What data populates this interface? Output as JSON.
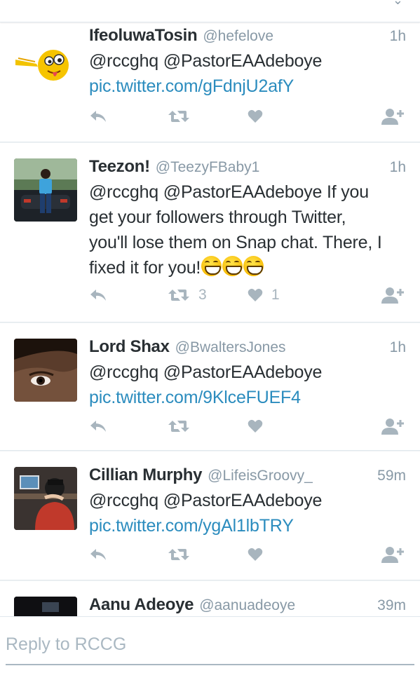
{
  "timeline": {
    "tweets": [
      {
        "name": "IfeoluwaTosin",
        "handle": "@hefelove",
        "time": "1h",
        "line1": "@rccghq @PastorEAAdeboye",
        "link": "pic.twitter.com/gFdnjU2afY",
        "retweet_count": "",
        "like_count": ""
      },
      {
        "name": "Teezon!",
        "handle": "@TeezyFBaby1",
        "time": "1h",
        "text_lines": [
          "@rccghq @PastorEAAdeboye If you",
          "get your followers through Twitter,",
          "you'll lose them on Snap chat. There, I",
          "fixed it for you!"
        ],
        "emoji_name": "grinning-face-emoji",
        "retweet_count": "3",
        "like_count": "1"
      },
      {
        "name": "Lord Shax",
        "handle": "@BwaltersJones",
        "time": "1h",
        "line1": "@rccghq @PastorEAAdeboye",
        "link": "pic.twitter.com/9KlceFUEF4",
        "retweet_count": "",
        "like_count": ""
      },
      {
        "name": "Cillian Murphy",
        "handle": "@LifeisGroovy_",
        "time": "59m",
        "line1": "@rccghq @PastorEAAdeboye",
        "link": "pic.twitter.com/ygAl1lbTRY",
        "retweet_count": "",
        "like_count": ""
      },
      {
        "name": "Aanu Adeoye",
        "handle": "@aanuadeoye",
        "time": "39m"
      }
    ]
  },
  "reply": {
    "placeholder": "Reply to RCCG"
  },
  "colors": {
    "link": "#2b8cbe",
    "muted": "#8899a6",
    "icon": "#a8b5be",
    "text": "#292f33"
  },
  "icons": [
    "reply-icon",
    "retweet-icon",
    "like-icon",
    "follow-icon",
    "chevron-down-icon"
  ]
}
